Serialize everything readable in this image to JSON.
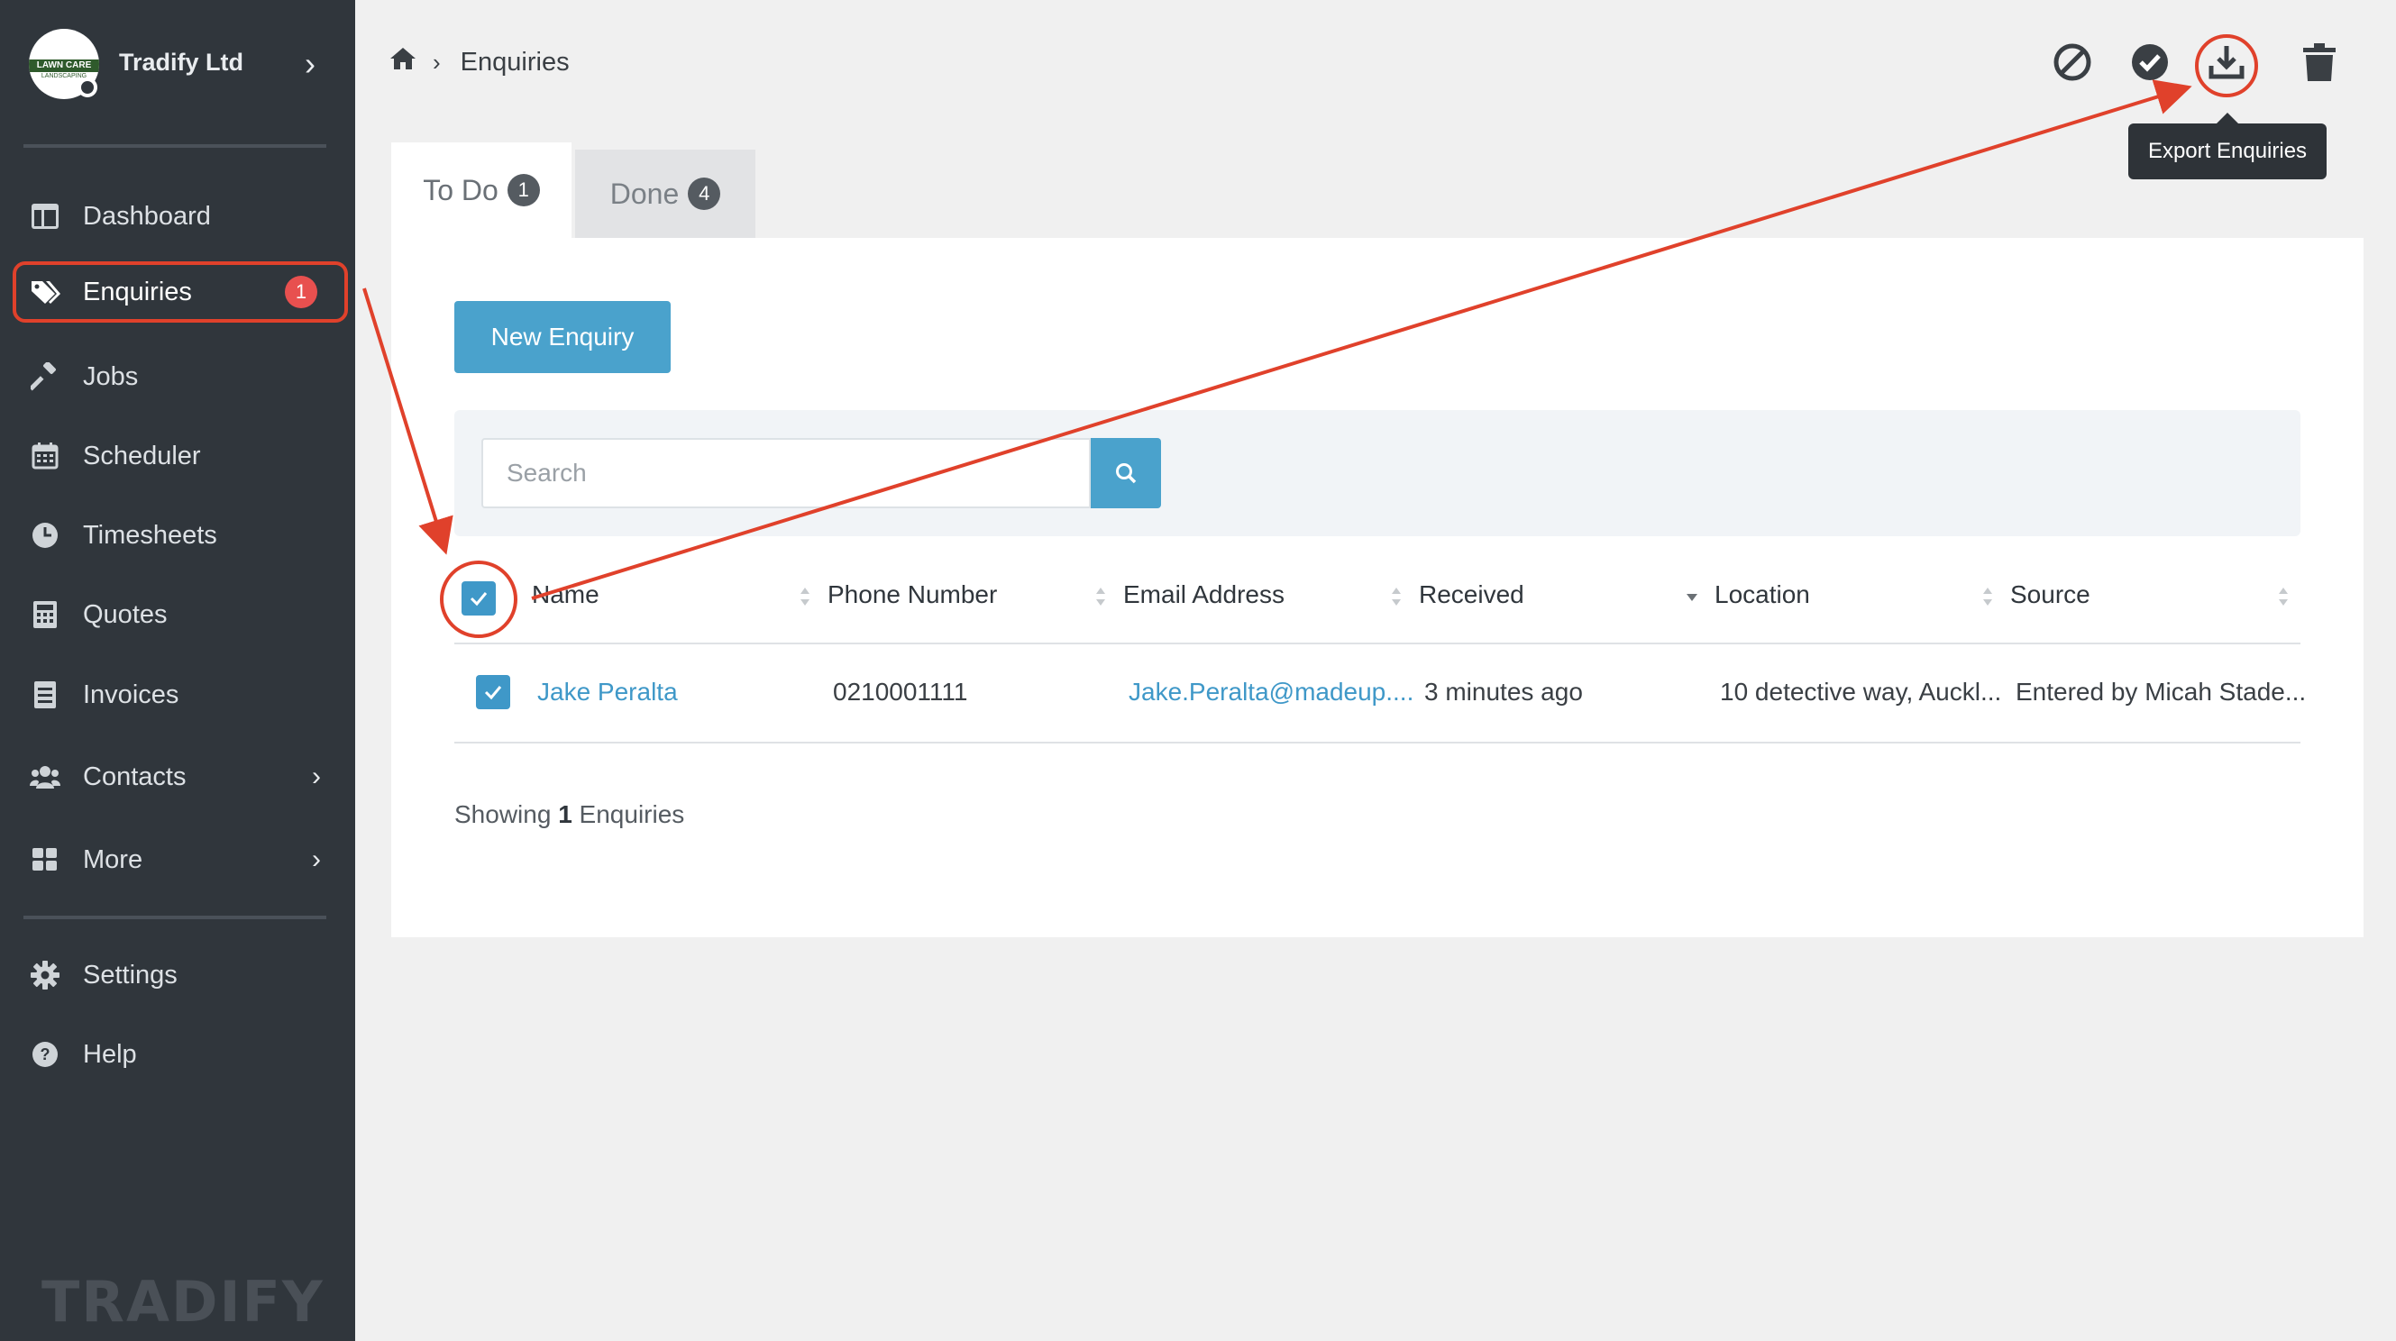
{
  "sidebar": {
    "company": "Tradify Ltd",
    "logo_text": "LAWN CARE",
    "logo_subtext": "LANDSCAPING",
    "items": [
      {
        "label": "Dashboard",
        "icon": "dashboard-icon"
      },
      {
        "label": "Enquiries",
        "icon": "tags-icon",
        "badge": "1"
      },
      {
        "label": "Jobs",
        "icon": "hammer-icon"
      },
      {
        "label": "Scheduler",
        "icon": "calendar-icon"
      },
      {
        "label": "Timesheets",
        "icon": "clock-icon"
      },
      {
        "label": "Quotes",
        "icon": "calculator-icon"
      },
      {
        "label": "Invoices",
        "icon": "invoice-icon"
      },
      {
        "label": "Contacts",
        "icon": "users-icon"
      },
      {
        "label": "More",
        "icon": "grid-icon"
      },
      {
        "label": "Settings",
        "icon": "gear-icon"
      },
      {
        "label": "Help",
        "icon": "help-icon"
      }
    ],
    "wordmark": "TRADIFY"
  },
  "breadcrumb": {
    "current": "Enquiries"
  },
  "toolbar": {
    "tooltip": "Export Enquiries"
  },
  "tabs": [
    {
      "label": "To Do",
      "count": "1"
    },
    {
      "label": "Done",
      "count": "4"
    }
  ],
  "main": {
    "new_button": "New Enquiry",
    "search_placeholder": "Search",
    "columns": [
      "Name",
      "Phone Number",
      "Email Address",
      "Received",
      "Location",
      "Source"
    ],
    "rows": [
      {
        "name": "Jake Peralta",
        "phone": "0210001111",
        "email": "Jake.Peralta@madeup....",
        "received": "3 minutes ago",
        "location": "10 detective way, Auckl...",
        "source": "Entered by Micah Stade..."
      }
    ],
    "showing_prefix": "Showing",
    "showing_count": "1",
    "showing_suffix": "Enquiries"
  },
  "colors": {
    "sidebar_bg": "#30363c",
    "accent": "#4aa2cc",
    "badge": "#e8504f",
    "annotation": "#e0412b"
  }
}
